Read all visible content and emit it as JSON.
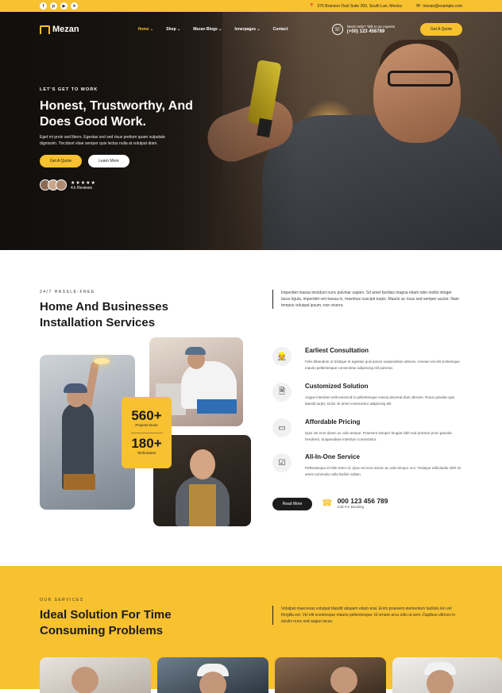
{
  "topbar": {
    "socials": [
      "f",
      "p",
      "▶",
      "✕"
    ],
    "address": "376 Branson Oval Suite 200, South Lan, Mexico",
    "email": "mezan@example.com"
  },
  "nav": {
    "logo": "Mezan",
    "menu": [
      "Home",
      "Shop",
      "Mezan Blogs",
      "Innerpages",
      "Contact"
    ],
    "help_label": "Need Help? Talk to an experts",
    "help_phone": "(+00) 123 456789",
    "quote_button": "Get A Quote"
  },
  "hero": {
    "eyebrow": "LET'S GET TO WORK",
    "title": "Honest, Trustworthy, And Does Good Work.",
    "description": "Eget mi proin sed libero. Egestas sed sed risus pretium quam vulputate dignissim. Tincidunt vitae semper quis lectus nulla at volutpat diam.",
    "primary_button": "Get A Quote",
    "secondary_button": "Learn More",
    "stars": "★★★★★",
    "reviews": "4.k Reviews"
  },
  "about": {
    "eyebrow": "24/7 HASSLE-FREE",
    "title": "Home And Businesses Installation Services",
    "description": "Imperdiet massa tincidunt nunc pulvinar sapien. Sit amet facilisis magna etiam odio mollis integer lacus ligula, imperdiet vel massa in, maximus suscipit turpis. Mauris ac risus sed semper auctor. Nam tempus volutpat ipsum, non viverra",
    "stats": [
      {
        "value": "560+",
        "label": "Projects Done"
      },
      {
        "value": "180+",
        "label": "Technicians"
      }
    ],
    "services": [
      {
        "title": "Earliest Consultation",
        "desc": "Felis bibendum ut tristique et egestas quis ipsum suspendisse ultrices. Aenean vel elit scelerisque mauris pellentesque consectetur adipiscing elit pulvinar.",
        "icon": "worker-icon"
      },
      {
        "title": "Customized Solution",
        "desc": "Augue interdum velit euismod in pellentesque massa placerat duis ultricies. Purus gravida quis blandit turpis. Dolor sit amet consectetur adipiscing elit.",
        "icon": "document-icon"
      },
      {
        "title": "Affordable Pricing",
        "desc": "Quis vel eros donec ac odio tempor. Praesent semper feugiat nibh sed pulvinar proin gravida hendrerit. Suspendisse interdum consectetur.",
        "icon": "money-icon"
      },
      {
        "title": "All-In-One Service",
        "desc": "Pellentesque id nibh tortor id. Quis vel eros donec ac odio tempor orci. Tristique sollicitudin nibh sit amet commodo nulla facilisi nullam.",
        "icon": "checklist-icon"
      }
    ],
    "read_more": "Read More",
    "call_number": "000 123 456 789",
    "call_label": "Call For Booking"
  },
  "services_section": {
    "eyebrow": "OUR SERVICES",
    "title": "Ideal Solution For Time Consuming Problems",
    "description": "Volutpat maecenas volutpat blandit aliquam etiam erat. Enim praesent elementum facilisis leo vel fringilla est. Vel elit scelerisque mauris pellentesque. Id ornare arcu odio ut sem. Dapibus ultrices in iaculis nunc sed augue lacus."
  },
  "colors": {
    "accent": "#f7c12f",
    "dark": "#1c1c1c"
  }
}
